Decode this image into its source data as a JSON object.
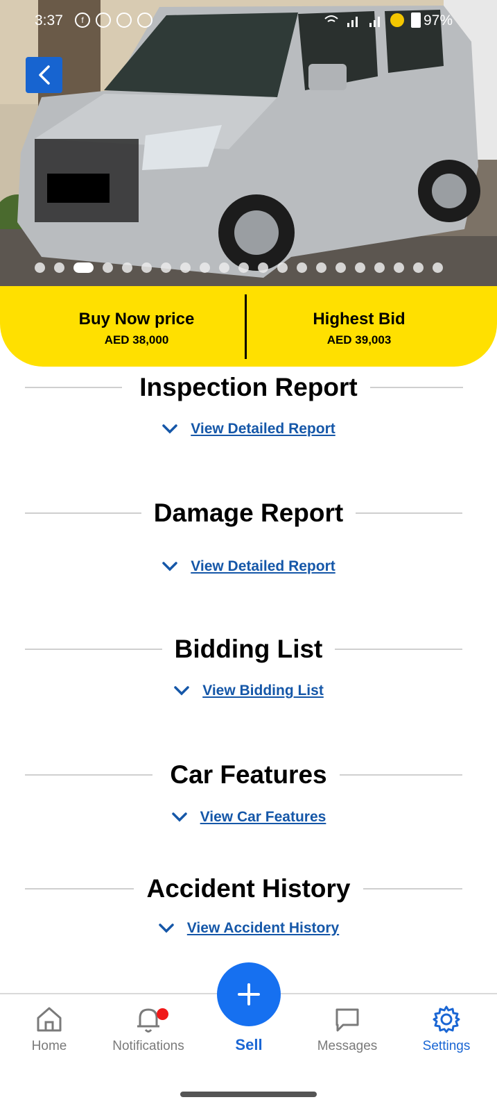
{
  "status_bar": {
    "time": "3:37",
    "battery": "97%"
  },
  "hero": {
    "image_count": 21,
    "active_index": 2
  },
  "price_banner": {
    "buy_now_label": "Buy Now price",
    "buy_now_value": "AED 38,000",
    "highest_bid_label": "Highest Bid",
    "highest_bid_value": "AED 39,003",
    "accent_color": "#ffe000"
  },
  "sections": {
    "inspection": {
      "title": "Inspection Report",
      "link": "View Detailed Report"
    },
    "damage": {
      "title": "Damage Report",
      "link": "View Detailed Report"
    },
    "bidding": {
      "title": "Bidding List",
      "link": "View Bidding List"
    },
    "features": {
      "title": "Car Features",
      "link": "View Car Features"
    },
    "accident": {
      "title": "Accident History",
      "link": "View Accident History"
    }
  },
  "bottom_nav": {
    "home": "Home",
    "notifications": "Notifications",
    "sell": "Sell",
    "messages": "Messages",
    "settings": "Settings",
    "active_color": "#1a66d4"
  }
}
